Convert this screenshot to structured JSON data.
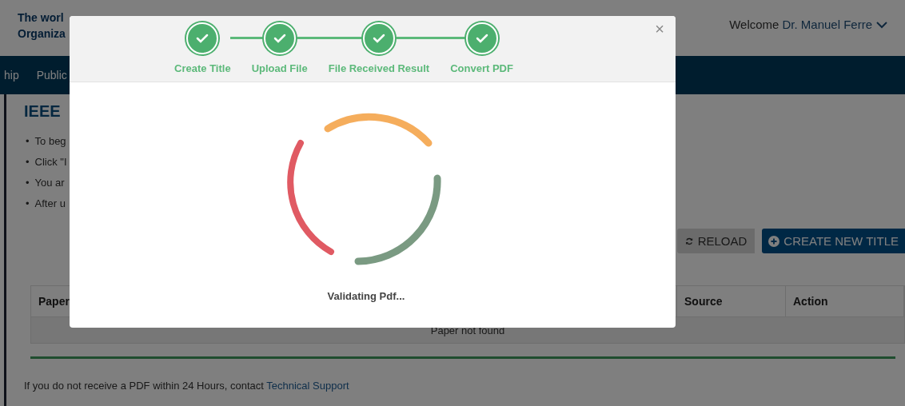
{
  "header": {
    "org_title_lines": [
      "The worl",
      "Organiza"
    ],
    "welcome": "Welcome",
    "user": "Dr. Manuel Ferre"
  },
  "nav": {
    "items": [
      "hip",
      "Public"
    ]
  },
  "page": {
    "heading": "IEEE",
    "bullet_marker": "•",
    "bullets": [
      "To beg",
      "Click \"I",
      "You ar",
      "After u"
    ],
    "buttons": [
      {
        "kind": "reload",
        "label": "RELOAD"
      },
      {
        "kind": "create",
        "label": "CREATE NEW TITLE"
      }
    ],
    "table": {
      "columns": [
        "Paper",
        "Source",
        "Action"
      ],
      "empty_message": "Paper not found"
    },
    "footer": {
      "text": "If you do not receive a PDF within 24 Hours, contact ",
      "link": "Technical Support"
    }
  },
  "modal": {
    "steps": [
      {
        "label": "Create Title",
        "done": true
      },
      {
        "label": "Upload File",
        "done": true
      },
      {
        "label": "File Received Result",
        "done": true
      },
      {
        "label": "Convert PDF",
        "done": true
      }
    ],
    "close": "×",
    "status": "Validating Pdf..."
  }
}
